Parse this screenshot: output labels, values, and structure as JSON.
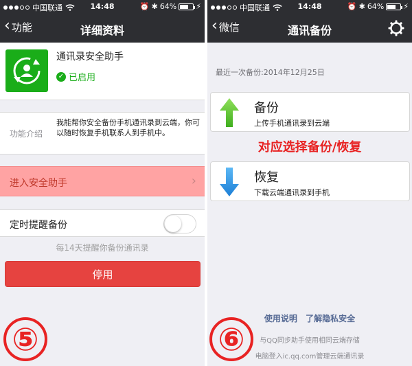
{
  "left": {
    "status": {
      "carrier": "中国联通",
      "time": "14:48",
      "battery": "64%",
      "battery_level": 0.64
    },
    "nav": {
      "back_label": "功能",
      "title": "详细资料"
    },
    "app": {
      "name": "通讯录安全助手",
      "status": "已启用"
    },
    "intro": {
      "label": "功能介绍",
      "text": "我能帮你安全备份手机通讯录到云端，你可以随时恢复手机联系人到手机中。"
    },
    "enter_label": "进入安全助手",
    "remind": {
      "label": "定时提醒备份",
      "enabled": false,
      "hint": "每14天提醒你备份通讯录"
    },
    "disable_label": "停用",
    "step": "⑤"
  },
  "right": {
    "status": {
      "carrier": "中国联通",
      "time": "14:48",
      "battery": "64%",
      "battery_level": 0.64
    },
    "nav": {
      "back_label": "微信",
      "title": "通讯备份"
    },
    "last_backup": "最近一次备份:2014年12月25日",
    "backup": {
      "title": "备份",
      "subtitle": "上传手机通讯录到云端"
    },
    "annotation": "对应选择备份/恢复",
    "restore": {
      "title": "恢复",
      "subtitle": "下载云端通讯录到手机"
    },
    "links": {
      "usage": "使用说明",
      "privacy": "了解隐私安全"
    },
    "footer1": "与QQ同步助手使用相同云端存储",
    "footer2": "电脑登入ic.qq.com管理云端通讯录",
    "step": "⑥"
  },
  "colors": {
    "nav_bg": "#2d2e32",
    "accent_green": "#1aad19",
    "danger": "#e64340",
    "annotation_red": "#e82323",
    "link_blue": "#576b95"
  }
}
